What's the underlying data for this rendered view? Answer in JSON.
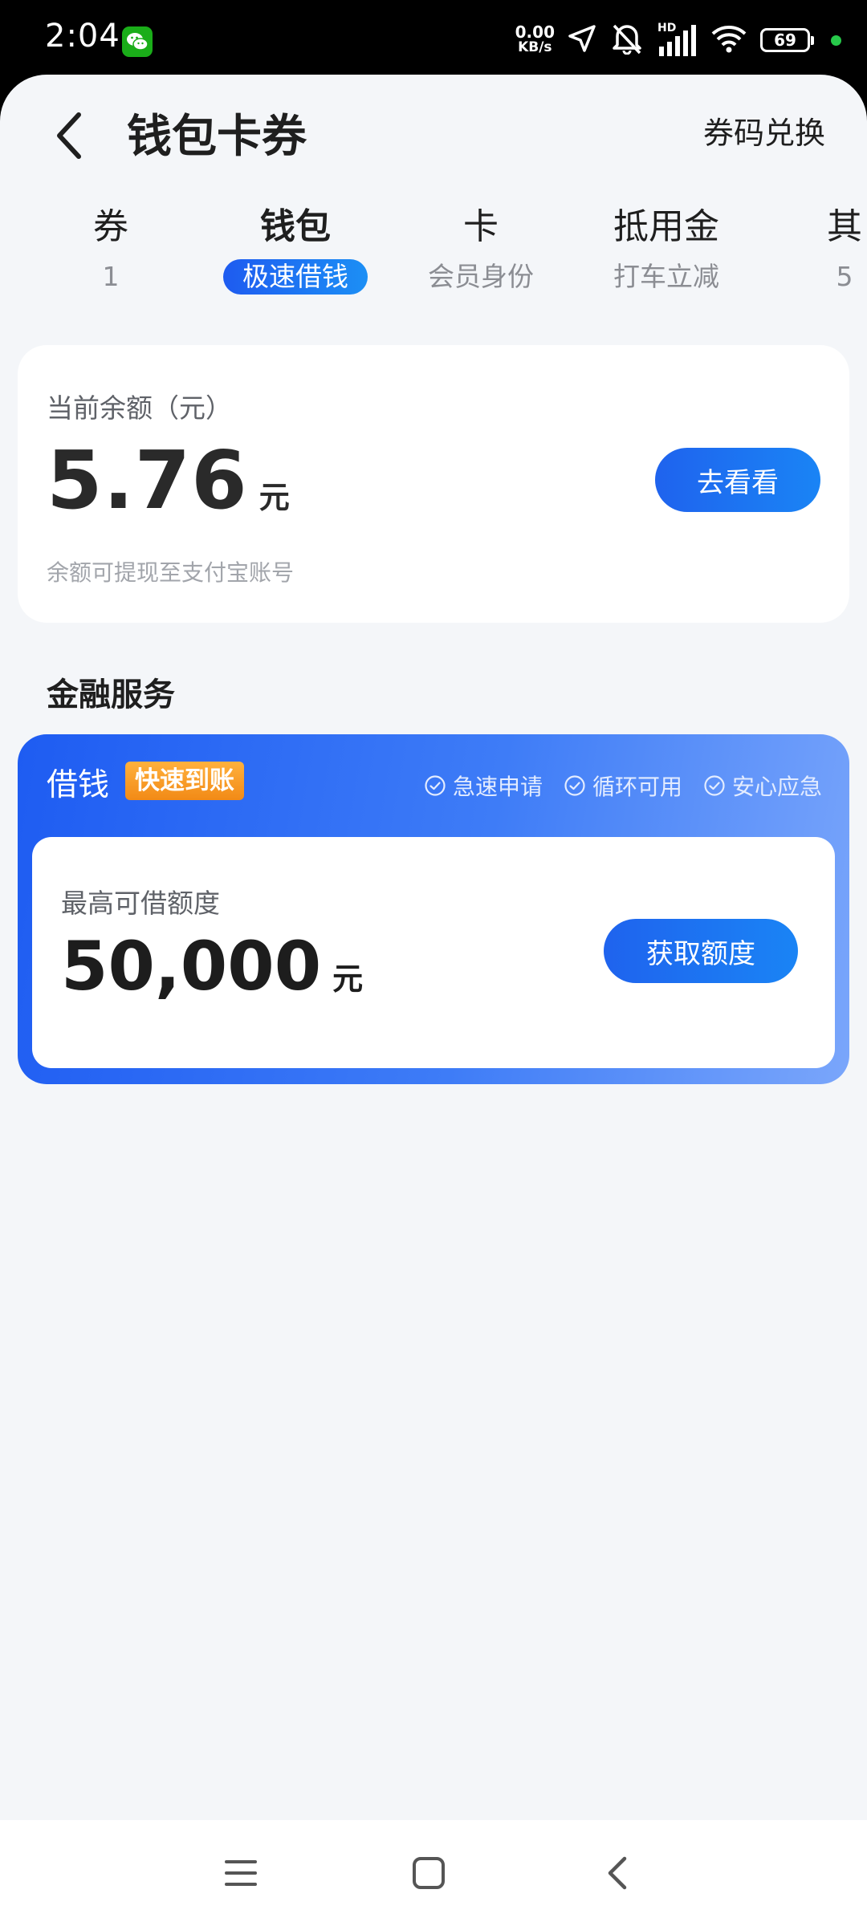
{
  "status_bar": {
    "time": "2:04",
    "net_speed_value": "0.00",
    "net_speed_unit": "KB/s",
    "hd_label": "HD",
    "battery": "69"
  },
  "header": {
    "title": "钱包卡券",
    "redeem_label": "券码兑换"
  },
  "tabs": [
    {
      "label": "券",
      "sub": "1",
      "active": false
    },
    {
      "label": "钱包",
      "sub": "极速借钱",
      "active": true
    },
    {
      "label": "卡",
      "sub": "会员身份",
      "active": false
    },
    {
      "label": "抵用金",
      "sub": "打车立减",
      "active": false
    },
    {
      "label": "其",
      "sub": "5",
      "active": false
    }
  ],
  "balance": {
    "label": "当前余额（元）",
    "amount": "5.76",
    "unit": "元",
    "button_label": "去看看",
    "note": "余额可提现至支付宝账号"
  },
  "finance": {
    "section_title": "金融服务",
    "loan_title": "借钱",
    "badge": "快速到账",
    "features": [
      "急速申请",
      "循环可用",
      "安心应急"
    ],
    "limit_label": "最高可借额度",
    "limit_amount": "50,000",
    "limit_unit": "元",
    "button_label": "获取额度"
  },
  "colors": {
    "accent_blue": "#1f63ee",
    "badge_orange": "#f28a16",
    "page_bg": "#f4f6f9"
  }
}
